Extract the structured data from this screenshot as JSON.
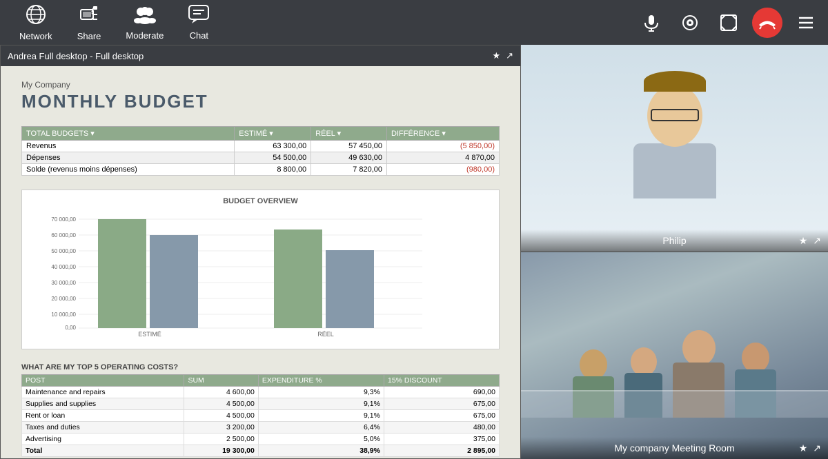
{
  "topbar": {
    "network_label": "Network",
    "share_label": "Share",
    "moderate_label": "Moderate",
    "chat_label": "Chat"
  },
  "screen_share": {
    "header_text": "Andrea Full desktop - Full desktop"
  },
  "document": {
    "subtitle": "My Company",
    "title": "MONTHLY BUDGET",
    "budget_table": {
      "headers": [
        "TOTAL BUDGETS",
        "ESTIMÉ",
        "RÉEL",
        "DIFFÉRENCE"
      ],
      "rows": [
        [
          "Revenus",
          "63 300,00",
          "57 450,00",
          "(5 850,00)"
        ],
        [
          "Dépenses",
          "54 500,00",
          "49 630,00",
          "4 870,00"
        ],
        [
          "Solde (revenus moins dépenses)",
          "8 800,00",
          "7 820,00",
          "(980,00)"
        ]
      ]
    },
    "chart": {
      "title": "BUDGET OVERVIEW",
      "y_labels": [
        "70 000,00",
        "60 000,00",
        "50 000,00",
        "40 000,00",
        "30 000,00",
        "20 000,00",
        "10 000,00",
        "0,00"
      ],
      "x_labels": [
        "ESTIMÉ",
        "RÉEL"
      ],
      "bars": {
        "estim_revenus": 63300,
        "estim_depenses": 54500,
        "reel_revenus": 57450,
        "reel_depenses": 49630,
        "max": 70000
      }
    },
    "costs_title": "WHAT ARE MY TOP 5 OPERATING COSTS?",
    "costs_table": {
      "headers": [
        "POST",
        "SUM",
        "EXPENDITURE %",
        "15% DISCOUNT"
      ],
      "rows": [
        [
          "Maintenance and repairs",
          "4 600,00",
          "9,3%",
          "690,00"
        ],
        [
          "Supplies and supplies",
          "4 500,00",
          "9,1%",
          "675,00"
        ],
        [
          "Rent or loan",
          "4 500,00",
          "9,1%",
          "675,00"
        ],
        [
          "Taxes and duties",
          "3 200,00",
          "6,4%",
          "480,00"
        ],
        [
          "Advertising",
          "2 500,00",
          "5,0%",
          "375,00"
        ]
      ],
      "total_row": [
        "Total",
        "19 300,00",
        "38,9%",
        "2 895,00"
      ]
    }
  },
  "video_top": {
    "label": "Philip",
    "star_icon": "★",
    "share_icon": "↗"
  },
  "video_bottom": {
    "label": "My company Meeting Room",
    "star_icon": "★",
    "share_icon": "↗"
  },
  "icons": {
    "mic": "🎤",
    "cam": "⊙",
    "fullscreen": "⛶",
    "hangup": "📞",
    "menu": "≡",
    "star": "★",
    "forward": "↗",
    "network_icon": "◎",
    "share_icon": "⬡",
    "moderate_icon": "👥",
    "chat_icon": "💬"
  }
}
